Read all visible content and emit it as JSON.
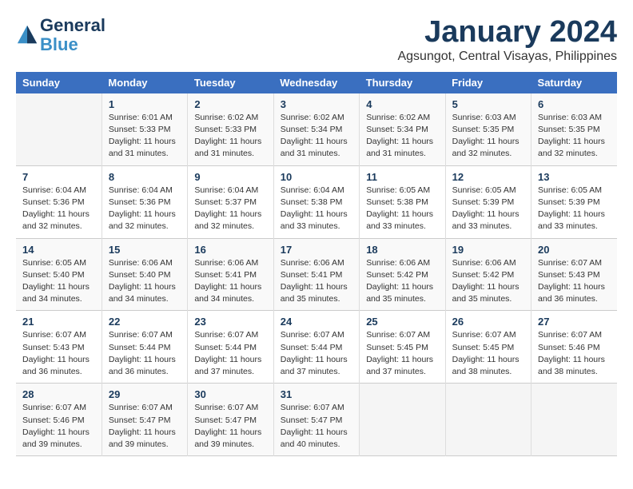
{
  "header": {
    "logo_line1": "General",
    "logo_line2": "Blue",
    "month": "January 2024",
    "location": "Agsungot, Central Visayas, Philippines"
  },
  "weekdays": [
    "Sunday",
    "Monday",
    "Tuesday",
    "Wednesday",
    "Thursday",
    "Friday",
    "Saturday"
  ],
  "weeks": [
    [
      {
        "day": "",
        "info": ""
      },
      {
        "day": "1",
        "info": "Sunrise: 6:01 AM\nSunset: 5:33 PM\nDaylight: 11 hours\nand 31 minutes."
      },
      {
        "day": "2",
        "info": "Sunrise: 6:02 AM\nSunset: 5:33 PM\nDaylight: 11 hours\nand 31 minutes."
      },
      {
        "day": "3",
        "info": "Sunrise: 6:02 AM\nSunset: 5:34 PM\nDaylight: 11 hours\nand 31 minutes."
      },
      {
        "day": "4",
        "info": "Sunrise: 6:02 AM\nSunset: 5:34 PM\nDaylight: 11 hours\nand 31 minutes."
      },
      {
        "day": "5",
        "info": "Sunrise: 6:03 AM\nSunset: 5:35 PM\nDaylight: 11 hours\nand 32 minutes."
      },
      {
        "day": "6",
        "info": "Sunrise: 6:03 AM\nSunset: 5:35 PM\nDaylight: 11 hours\nand 32 minutes."
      }
    ],
    [
      {
        "day": "7",
        "info": "Sunrise: 6:04 AM\nSunset: 5:36 PM\nDaylight: 11 hours\nand 32 minutes."
      },
      {
        "day": "8",
        "info": "Sunrise: 6:04 AM\nSunset: 5:36 PM\nDaylight: 11 hours\nand 32 minutes."
      },
      {
        "day": "9",
        "info": "Sunrise: 6:04 AM\nSunset: 5:37 PM\nDaylight: 11 hours\nand 32 minutes."
      },
      {
        "day": "10",
        "info": "Sunrise: 6:04 AM\nSunset: 5:38 PM\nDaylight: 11 hours\nand 33 minutes."
      },
      {
        "day": "11",
        "info": "Sunrise: 6:05 AM\nSunset: 5:38 PM\nDaylight: 11 hours\nand 33 minutes."
      },
      {
        "day": "12",
        "info": "Sunrise: 6:05 AM\nSunset: 5:39 PM\nDaylight: 11 hours\nand 33 minutes."
      },
      {
        "day": "13",
        "info": "Sunrise: 6:05 AM\nSunset: 5:39 PM\nDaylight: 11 hours\nand 33 minutes."
      }
    ],
    [
      {
        "day": "14",
        "info": "Sunrise: 6:05 AM\nSunset: 5:40 PM\nDaylight: 11 hours\nand 34 minutes."
      },
      {
        "day": "15",
        "info": "Sunrise: 6:06 AM\nSunset: 5:40 PM\nDaylight: 11 hours\nand 34 minutes."
      },
      {
        "day": "16",
        "info": "Sunrise: 6:06 AM\nSunset: 5:41 PM\nDaylight: 11 hours\nand 34 minutes."
      },
      {
        "day": "17",
        "info": "Sunrise: 6:06 AM\nSunset: 5:41 PM\nDaylight: 11 hours\nand 35 minutes."
      },
      {
        "day": "18",
        "info": "Sunrise: 6:06 AM\nSunset: 5:42 PM\nDaylight: 11 hours\nand 35 minutes."
      },
      {
        "day": "19",
        "info": "Sunrise: 6:06 AM\nSunset: 5:42 PM\nDaylight: 11 hours\nand 35 minutes."
      },
      {
        "day": "20",
        "info": "Sunrise: 6:07 AM\nSunset: 5:43 PM\nDaylight: 11 hours\nand 36 minutes."
      }
    ],
    [
      {
        "day": "21",
        "info": "Sunrise: 6:07 AM\nSunset: 5:43 PM\nDaylight: 11 hours\nand 36 minutes."
      },
      {
        "day": "22",
        "info": "Sunrise: 6:07 AM\nSunset: 5:44 PM\nDaylight: 11 hours\nand 36 minutes."
      },
      {
        "day": "23",
        "info": "Sunrise: 6:07 AM\nSunset: 5:44 PM\nDaylight: 11 hours\nand 37 minutes."
      },
      {
        "day": "24",
        "info": "Sunrise: 6:07 AM\nSunset: 5:44 PM\nDaylight: 11 hours\nand 37 minutes."
      },
      {
        "day": "25",
        "info": "Sunrise: 6:07 AM\nSunset: 5:45 PM\nDaylight: 11 hours\nand 37 minutes."
      },
      {
        "day": "26",
        "info": "Sunrise: 6:07 AM\nSunset: 5:45 PM\nDaylight: 11 hours\nand 38 minutes."
      },
      {
        "day": "27",
        "info": "Sunrise: 6:07 AM\nSunset: 5:46 PM\nDaylight: 11 hours\nand 38 minutes."
      }
    ],
    [
      {
        "day": "28",
        "info": "Sunrise: 6:07 AM\nSunset: 5:46 PM\nDaylight: 11 hours\nand 39 minutes."
      },
      {
        "day": "29",
        "info": "Sunrise: 6:07 AM\nSunset: 5:47 PM\nDaylight: 11 hours\nand 39 minutes."
      },
      {
        "day": "30",
        "info": "Sunrise: 6:07 AM\nSunset: 5:47 PM\nDaylight: 11 hours\nand 39 minutes."
      },
      {
        "day": "31",
        "info": "Sunrise: 6:07 AM\nSunset: 5:47 PM\nDaylight: 11 hours\nand 40 minutes."
      },
      {
        "day": "",
        "info": ""
      },
      {
        "day": "",
        "info": ""
      },
      {
        "day": "",
        "info": ""
      }
    ]
  ]
}
